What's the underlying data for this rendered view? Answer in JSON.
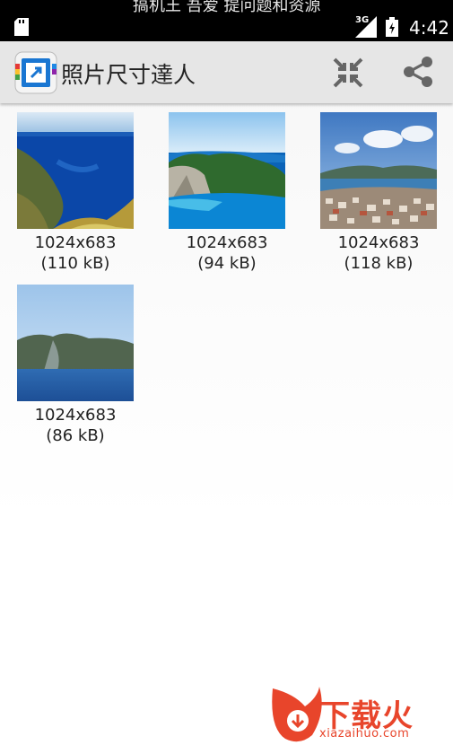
{
  "status_bar": {
    "cut_text": "搞机王 吾爱 提问题和资源",
    "network_type": "3G",
    "time": "4:42"
  },
  "action_bar": {
    "title": "照片尺寸達人",
    "icons": {
      "logo": "app-logo-icon",
      "compress": "compress-icon",
      "share": "share-icon"
    }
  },
  "photos": [
    {
      "dims": "1024x683",
      "size": "(110 kB)"
    },
    {
      "dims": "1024x683",
      "size": "(94 kB)"
    },
    {
      "dims": "1024x683",
      "size": "(118 kB)"
    },
    {
      "dims": "1024x683",
      "size": "(86 kB)"
    }
  ],
  "watermark": {
    "text": "下载火",
    "url": "xiazaihuo.com"
  },
  "colors": {
    "status_bar": "#000000",
    "action_bar": "#e6e6e6",
    "watermark": "#e8452b"
  }
}
